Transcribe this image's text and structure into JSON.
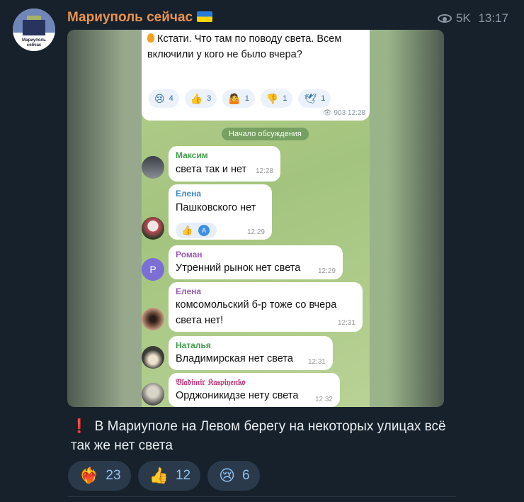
{
  "channel": {
    "name": "Мариуполь сейчас",
    "views": "5K",
    "time": "13:17",
    "avatar_text": "Мариуполь сейчас"
  },
  "screenshot": {
    "top_message": {
      "text": "Кстати. Что там по поводу света. Всем включили у кого не было вчера?",
      "reactions": [
        {
          "icon": "😢",
          "count": "4"
        },
        {
          "icon": "👍",
          "count": "3"
        },
        {
          "icon": "🤷",
          "count": "1"
        },
        {
          "icon": "👎",
          "count": "1"
        },
        {
          "icon": "🕊",
          "count": "1"
        }
      ],
      "views": "903",
      "time": "12:28"
    },
    "discussion_label": "Начало обсуждения",
    "messages": [
      {
        "author": "Максим",
        "author_color": "#3f9e4a",
        "text": "света так и нет",
        "time": "12:28"
      },
      {
        "author": "Елена",
        "author_color": "#3a89c9",
        "text": "Пашковского нет",
        "time": "12:29",
        "reaction_letter": "A"
      },
      {
        "author": "Роман",
        "author_color": "#9b59b6",
        "text": "Утренний рынок нет света",
        "time": "12:29",
        "avatar_letter": "Р"
      },
      {
        "author": "Елена",
        "author_color": "#9b59b6",
        "text": "комсомольский б-р тоже со вчера света нет!",
        "time": "12:31"
      },
      {
        "author": "Наталья",
        "author_color": "#3f9e4a",
        "text": "Владимирская нет света",
        "time": "12:31"
      },
      {
        "author": "𝔙𝔩𝔞𝔡𝔦𝔪𝔦𝔯 𝔎𝔞𝔰𝔭𝔦𝔶𝔢𝔫𝔨𝔬",
        "author_color": "#c0397a",
        "text": "Орджоникидзе нету света",
        "time": "12:32"
      }
    ]
  },
  "caption": {
    "icon": "❗",
    "text": "В Мариуполе на Левом берегу на некоторых улицах всё так же нет света"
  },
  "reactions": [
    {
      "icon": "❤️‍🔥",
      "name": "heart-on-fire-icon",
      "count": "23"
    },
    {
      "icon": "👍",
      "name": "thumbs-up-icon",
      "count": "12"
    },
    {
      "icon": "😢",
      "name": "crying-face-icon",
      "count": "6"
    }
  ],
  "colors": {
    "background": "#17212b",
    "channel_name": "#e99350",
    "reaction_chip": "#2b3a4b",
    "reaction_count": "#8dc2f0"
  }
}
